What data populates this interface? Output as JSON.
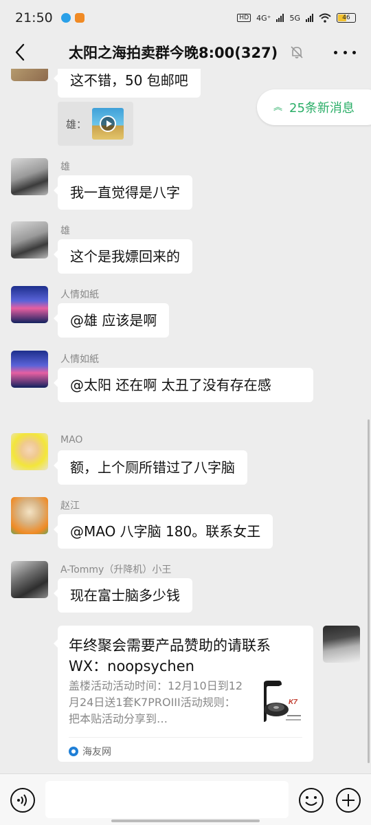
{
  "status_bar": {
    "time": "21:50",
    "network_1": "4G⁺",
    "network_2": "5G",
    "hd_label": "HD",
    "battery": "46"
  },
  "header": {
    "title": "太阳之海拍卖群今晚8:00(327)"
  },
  "new_messages": {
    "label": "25条新消息"
  },
  "messages": [
    {
      "text": "这不错，50 包邮吧",
      "quote": {
        "sender": "雄："
      }
    },
    {
      "sender": "雄",
      "text": "我一直觉得是八字"
    },
    {
      "sender": "雄",
      "text": "这个是我嫖回来的"
    },
    {
      "sender": "人情如紙",
      "text": "@雄  应该是啊"
    },
    {
      "sender": "人情如紙",
      "text": "@太阳  还在啊   太丑了没有存在感"
    },
    {
      "sender": "MAO",
      "text": "额，上个厕所错过了八字脑"
    },
    {
      "sender": "赵江",
      "text": "@MAO  八字脑 180。联系女王"
    },
    {
      "sender": "A-Tommy（升降机）小王",
      "text": "现在富士脑多少钱"
    }
  ],
  "link_card": {
    "title": "年终聚会需要产品赞助的请联系WX：noopsychen",
    "description": "盖楼活动活动时间：12月10日到12月24日送1套K7PROIII活动规则：把本贴活动分享到…",
    "source": "海友网",
    "image_logo": "K7"
  },
  "colors": {
    "background": "#ededed",
    "bubble": "#ffffff",
    "accent_green": "#2aae67"
  },
  "icons": {
    "back": "chevron-left-icon",
    "mute": "bell-off-icon",
    "more": "more-dots-icon",
    "voice": "voice-icon",
    "emoji": "emoji-icon",
    "plus": "plus-icon"
  }
}
